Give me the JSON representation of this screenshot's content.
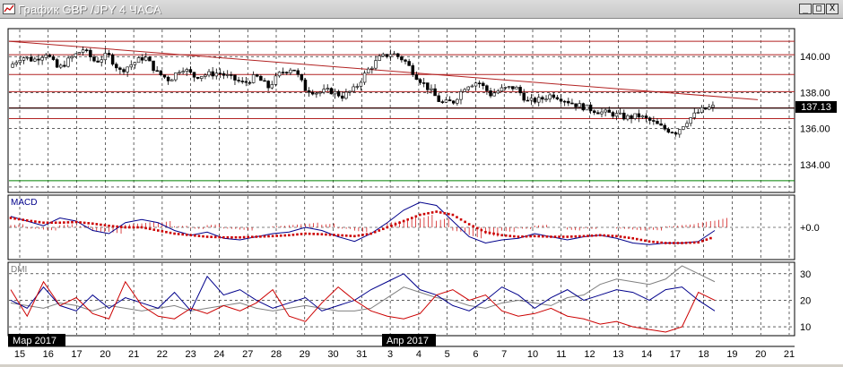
{
  "window": {
    "title": "График GBP /JPY  4 ЧАСА",
    "buttons": {
      "minimize": "_",
      "maximize": "□",
      "close": "X"
    }
  },
  "colors": {
    "up_candle": "#ffffff",
    "down_candle": "#000000",
    "resistance_line": "#b22222",
    "support_line": "#008000",
    "trendline": "#b22222",
    "grid": "#000000",
    "macd_line": "#00008b",
    "signal_line": "#cc0000",
    "di_plus": "#00008b",
    "di_minus": "#cc0000",
    "adx": "#808080"
  },
  "icons": {
    "app": "chart-window-icon"
  },
  "chart_data": [
    {
      "type": "candlestick",
      "title": "",
      "ylim": [
        132.5,
        141.5
      ],
      "y_ticks": [
        "140.00",
        "138.00",
        "136.00",
        "134.00"
      ],
      "current_price": "137.13",
      "horizontal_levels": [
        140.85,
        140.1,
        139.0,
        138.05,
        137.15,
        136.55
      ],
      "support_level": 133.1,
      "dashed_level": 132.75,
      "close_path": [
        139.4,
        140.0,
        139.8,
        140.2,
        139.3,
        139.9,
        140.4,
        139.7,
        140.1,
        139.2,
        139.6,
        140.0,
        139.1,
        138.7,
        139.4,
        138.9,
        139.0,
        139.1,
        138.8,
        138.5,
        138.9,
        138.3,
        139.1,
        139.4,
        138.2,
        138.0,
        138.1,
        137.8,
        138.2,
        139.2,
        139.9,
        140.2,
        139.8,
        138.9,
        138.2,
        137.4,
        137.5,
        138.4,
        138.6,
        137.9,
        138.2,
        138.3,
        137.5,
        137.6,
        137.9,
        137.6,
        137.3,
        137.1,
        136.9,
        136.8,
        136.6,
        136.7,
        136.4,
        136.0,
        135.8,
        136.5,
        137.0,
        137.2
      ],
      "x_ticks": [
        "15",
        "16",
        "17",
        "20",
        "21",
        "22",
        "23",
        "24",
        "27",
        "28",
        "29",
        "30",
        "31",
        "3",
        "4",
        "5",
        "6",
        "7",
        "10",
        "11",
        "12",
        "13",
        "14",
        "17",
        "18",
        "19",
        "20",
        "21"
      ],
      "period_labels": [
        "Мар 2017",
        "Апр 2017"
      ]
    },
    {
      "type": "line",
      "name": "MACD",
      "title": "MACD",
      "ylim": [
        -1,
        1
      ],
      "y_ticks": [
        "+0.0"
      ],
      "macd": [
        0.35,
        0.2,
        0.05,
        0.3,
        0.2,
        -0.1,
        -0.2,
        0.15,
        0.25,
        0.15,
        -0.1,
        -0.25,
        -0.15,
        -0.35,
        -0.4,
        -0.3,
        -0.2,
        -0.15,
        0.0,
        -0.1,
        -0.3,
        -0.45,
        -0.2,
        0.15,
        0.55,
        0.8,
        0.7,
        0.2,
        -0.3,
        -0.5,
        -0.4,
        -0.35,
        -0.2,
        -0.3,
        -0.4,
        -0.3,
        -0.25,
        -0.35,
        -0.5,
        -0.55,
        -0.5,
        -0.5,
        -0.45,
        -0.1
      ],
      "signal": [
        0.3,
        0.22,
        0.15,
        0.15,
        0.17,
        0.12,
        0.05,
        0.0,
        0.0,
        -0.1,
        -0.2,
        -0.25,
        -0.3,
        -0.32,
        -0.32,
        -0.3,
        -0.28,
        -0.25,
        -0.2,
        -0.22,
        -0.25,
        -0.28,
        -0.2,
        0.0,
        0.2,
        0.4,
        0.5,
        0.4,
        0.1,
        -0.15,
        -0.25,
        -0.3,
        -0.28,
        -0.3,
        -0.3,
        -0.28,
        -0.25,
        -0.28,
        -0.35,
        -0.45,
        -0.5,
        -0.5,
        -0.48,
        -0.3
      ],
      "histogram": [
        0.1,
        -0.05,
        -0.1,
        0.1,
        0.05,
        -0.15,
        -0.2,
        0.12,
        0.18,
        0.2,
        0.05,
        -0.05,
        0.1,
        -0.05,
        -0.1,
        0.0,
        0.05,
        0.1,
        0.15,
        0.12,
        -0.05,
        -0.15,
        0.0,
        0.2,
        0.35,
        0.4,
        0.3,
        -0.15,
        -0.35,
        -0.3,
        -0.15,
        -0.05,
        0.08,
        0.0,
        -0.1,
        -0.05,
        0.0,
        -0.05,
        -0.1,
        -0.1,
        0.05,
        0.1,
        0.2,
        0.3
      ]
    },
    {
      "type": "line",
      "name": "DMI",
      "title": "DMI",
      "ylim": [
        7,
        34
      ],
      "y_ticks": [
        "30",
        "20",
        "10"
      ],
      "di_plus": [
        20,
        17,
        25,
        18,
        16,
        22,
        17,
        21,
        19,
        17,
        23,
        16,
        29,
        22,
        24,
        20,
        17,
        19,
        21,
        16,
        18,
        20,
        24,
        27,
        30,
        24,
        22,
        18,
        16,
        20,
        25,
        22,
        17,
        21,
        24,
        20,
        22,
        24,
        23,
        20,
        24,
        25,
        20,
        16
      ],
      "di_minus": [
        24,
        14,
        27,
        18,
        21,
        15,
        13,
        27,
        18,
        14,
        13,
        17,
        15,
        18,
        16,
        19,
        24,
        14,
        12,
        19,
        25,
        20,
        16,
        14,
        13,
        15,
        22,
        24,
        20,
        22,
        16,
        14,
        15,
        17,
        14,
        13,
        11,
        12,
        10,
        9,
        8,
        10,
        23,
        20
      ],
      "adx": [
        19,
        18,
        17,
        19,
        18,
        16,
        18,
        17,
        16,
        17,
        18,
        16,
        17,
        18,
        19,
        17,
        16,
        17,
        18,
        17,
        16,
        16,
        17,
        21,
        25,
        23,
        21,
        20,
        18,
        17,
        19,
        20,
        19,
        18,
        21,
        22,
        26,
        28,
        27,
        26,
        28,
        33,
        30,
        27
      ]
    }
  ]
}
